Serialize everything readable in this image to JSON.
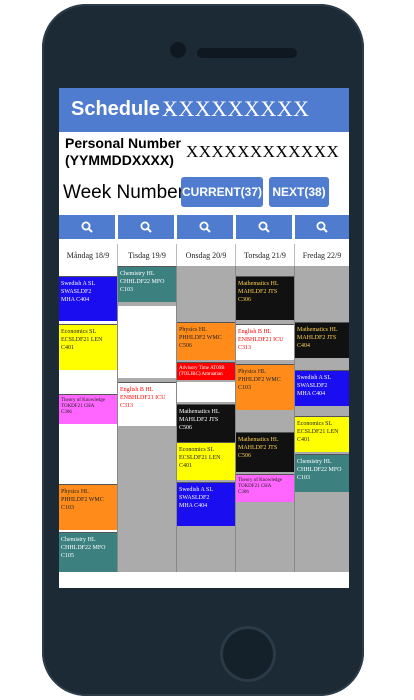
{
  "header": {
    "title_label": "Schedule -",
    "title_value": "XXXXXXXXX"
  },
  "personal": {
    "label": "Personal Number (YYMMDDXXXX)",
    "value": "XXXXXXXXXXXX"
  },
  "week": {
    "label": "Week Number",
    "current_button": "CURRENT(37)",
    "next_button": "NEXT(38)"
  },
  "days": [
    "Måndag 18/9",
    "Tisdag 19/9",
    "Onsdag 20/9",
    "Torsdag 21/9",
    "Fredag 22/9"
  ],
  "lessons": {
    "mon_1": {
      "l1": "Swedish A SL",
      "l2": "SWASLDF2",
      "l3": "MHA  C404"
    },
    "mon_2": {
      "l1": "Economics SL",
      "l2": "ECSLDF21  LEN",
      "l3": "C401"
    },
    "mon_3": {
      "l1": "Theory of Knowledge",
      "l2": "TOKDF21  CHA",
      "l3": "C306"
    },
    "mon_4": {
      "l1": "Physics HL",
      "l2": "PHHLDF2  WMC",
      "l3": "C103"
    },
    "mon_5": {
      "l1": "Chemistry HL",
      "l2": "CHHLDF22  MFO",
      "l3": "C105"
    },
    "tue_1": {
      "l1": "Chemistry HL",
      "l2": "CHHLDF22  MFO",
      "l3": "C103"
    },
    "tue_2": {
      "l1": "English B HL",
      "l2": "ENBHLDF21  ICU",
      "l3": "C313"
    },
    "wed_1": {
      "l1": "Physics HL",
      "l2": "PHHLDF2  WMC",
      "l3": "C506"
    },
    "wed_2": {
      "l1": "Advisory Time AT09B",
      "l2": "(TOLJBC) Amraatian",
      "l3": ""
    },
    "wed_3": {
      "l1": "Mathematics HL",
      "l2": "MAHLDF2  JTS",
      "l3": "C506"
    },
    "wed_4": {
      "l1": "Economics SL",
      "l2": "ECSLDF21  LEN",
      "l3": "C401"
    },
    "wed_5": {
      "l1": "Swedish A SL",
      "l2": "SWASLDF2",
      "l3": "MHA  C404"
    },
    "thu_1": {
      "l1": "Mathematics HL",
      "l2": "MAHLDF2  JTS",
      "l3": "C306"
    },
    "thu_2": {
      "l1": "English B HL",
      "l2": "ENBHLDF21  ICU",
      "l3": "C313"
    },
    "thu_3": {
      "l1": "Physics HL",
      "l2": "PHHLDF2  WMC",
      "l3": "C103"
    },
    "thu_4": {
      "l1": "Mathematics HL",
      "l2": "MAHLDF2  JTS",
      "l3": "C506"
    },
    "thu_5": {
      "l1": "Theory of Knowledge",
      "l2": "TOKDF21  CHA",
      "l3": "C306"
    },
    "fri_1": {
      "l1": "Mathematics HL",
      "l2": "MAHLDF2  JTS",
      "l3": "C404"
    },
    "fri_2": {
      "l1": "Swedish A SL",
      "l2": "SWASLDF2",
      "l3": "MHA  C404"
    },
    "fri_3": {
      "l1": "Economics SL",
      "l2": "ECSLDF21  LEN",
      "l3": "C401"
    },
    "fri_4": {
      "l1": "Chemistry HL",
      "l2": "CHHLDF22  MFO",
      "l3": "C103"
    }
  },
  "colors": {
    "accent": "#4f7ccf",
    "blue": "#1a0df0",
    "yellow": "#ffff00",
    "pink": "#ff66ff",
    "orange": "#ff8c1a",
    "teal": "#3d8080",
    "black": "#111111",
    "red": "#ff0000",
    "white": "#ffffff",
    "grid_gray": "#ababab"
  },
  "icons": {
    "search": "search-icon"
  }
}
